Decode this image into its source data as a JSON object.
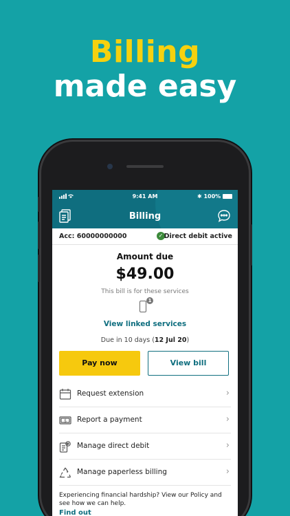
{
  "headline": {
    "line1": "Billing",
    "line2": "made easy"
  },
  "status_bar": {
    "time": "9:41 AM",
    "battery": "100%"
  },
  "app_bar": {
    "title": "Billing"
  },
  "account": {
    "number": "Acc: 60000000000",
    "direct_debit_status": "Direct debit active"
  },
  "summary": {
    "amount_label": "Amount due",
    "amount": "$49.00",
    "services_text": "This bill is for these services",
    "service_count": "1",
    "linked_services": "View linked services",
    "due_prefix": "Due in 10 days (",
    "due_date": "12 Jul 20",
    "due_suffix": ")"
  },
  "actions": {
    "pay_now": "Pay now",
    "view_bill": "View bill"
  },
  "menu": {
    "items": [
      {
        "label": "Request extension",
        "icon": "calendar-icon"
      },
      {
        "label": "Report a payment",
        "icon": "cash-icon"
      },
      {
        "label": "Manage direct debit",
        "icon": "bill-settings-icon"
      },
      {
        "label": "Manage paperless billing",
        "icon": "recycle-icon"
      }
    ]
  },
  "hardship": {
    "text": "Experiencing financial hardship? View our Policy and see how we can help.",
    "link": "Find out"
  },
  "colors": {
    "background": "#14a2a6",
    "accent_yellow": "#f6c90e",
    "brand_teal": "#0f6e7f"
  }
}
